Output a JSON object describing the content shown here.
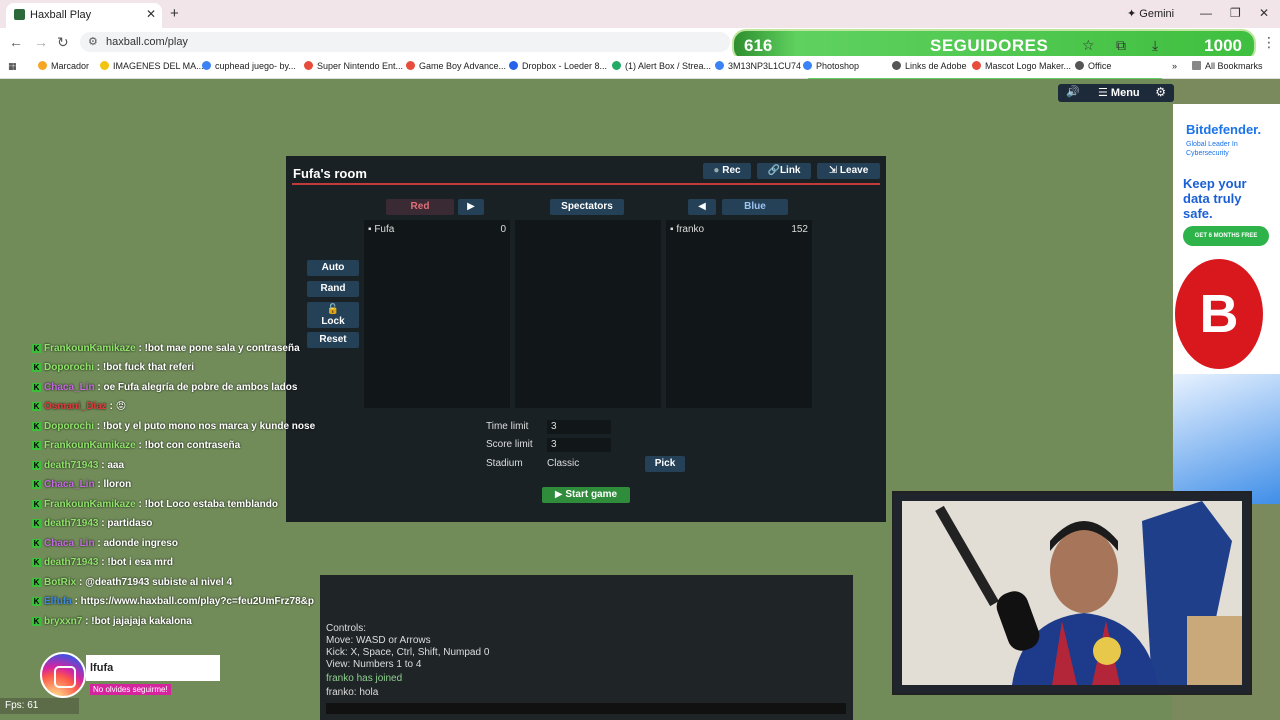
{
  "browser": {
    "tab_title": "Haxball Play",
    "url": "haxball.com/play",
    "gemini_label": "Gemini",
    "bookmarks": [
      "Marcador",
      "IMAGENES DEL MA...",
      "cuphead juego- by...",
      "Super Nintendo Ent...",
      "Game Boy Advance...",
      "Dropbox - Loeder 8...",
      "(1) Alert Box / Strea...",
      "3M13NP3L1CU74",
      "Photoshop",
      "Links de Adobe",
      "Mascot Logo Maker...",
      "Office"
    ],
    "all_bookmarks": "All Bookmarks"
  },
  "followers": {
    "count": "616",
    "label": "SEGUIDORES",
    "goal": "1000"
  },
  "game_menu": {
    "menu_label": "Menu"
  },
  "room": {
    "title": "Fufa's room",
    "rec_label": "Rec",
    "link_label": "Link",
    "leave_label": "Leave",
    "red_label": "Red",
    "spectators_label": "Spectators",
    "blue_label": "Blue",
    "red_players": [
      {
        "name": "Fufa",
        "score": "0"
      }
    ],
    "blue_players": [
      {
        "name": "franko",
        "score": "152"
      }
    ],
    "side_buttons": [
      "Auto",
      "Rand",
      "Lock",
      "Reset"
    ],
    "time_limit_label": "Time limit",
    "time_limit": "3",
    "score_limit_label": "Score limit",
    "score_limit": "3",
    "stadium_label": "Stadium",
    "stadium": "Classic",
    "pick_label": "Pick",
    "start_label": "Start game"
  },
  "chat": [
    {
      "user": "FrankounKamikaze",
      "msg": ": !bot mae pone sala y contraseña",
      "color": "#8fe36a"
    },
    {
      "user": "Doporochi",
      "msg": ": !bot fuck that referi",
      "color": "#8fe36a"
    },
    {
      "user": "Chaca_Lin",
      "msg": ": oe Fufa alegría de pobre de ambos lados",
      "color": "#c46be0"
    },
    {
      "user": "Osmani_Diaz",
      "msg": ": 😡",
      "color": "#e23a3a"
    },
    {
      "user": "Doporochi",
      "msg": ": !bot y el puto mono nos marca y kunde nose",
      "color": "#8fe36a"
    },
    {
      "user": "FrankounKamikaze",
      "msg": ": !bot con contraseña",
      "color": "#8fe36a"
    },
    {
      "user": "death71943",
      "msg": ": aaa",
      "color": "#8fe36a"
    },
    {
      "user": "Chaca_Lin",
      "msg": ": lloron",
      "color": "#c46be0"
    },
    {
      "user": "FrankounKamikaze",
      "msg": ": !bot Loco estaba temblando",
      "color": "#8fe36a"
    },
    {
      "user": "death71943",
      "msg": ": partidaso",
      "color": "#8fe36a"
    },
    {
      "user": "Chaca_Lin",
      "msg": ": adonde ingreso",
      "color": "#c46be0"
    },
    {
      "user": "death71943",
      "msg": ": !bot i esa mrd",
      "color": "#8fe36a"
    },
    {
      "user": "BotRix",
      "msg": ": @death71943 subiste al nivel 4",
      "color": "#8fe36a"
    },
    {
      "user": "Elfufa",
      "msg": ": https://www.haxball.com/play?c=feu2UmFrz78&p",
      "color": "#3a8ae2"
    },
    {
      "user": "bryxxn7",
      "msg": ": !bot jajajaja kakalona",
      "color": "#8fe36a"
    }
  ],
  "controls": {
    "lines": [
      "Controls:",
      "Move: WASD or Arrows",
      "Kick: X, Space, Ctrl, Shift, Numpad 0",
      "View: Numbers 1 to 4"
    ],
    "joined": "franko has joined",
    "last_msg": "franko: hola"
  },
  "ad": {
    "brand": "Bitdefender.",
    "sub": "Global Leader In Cybersecurity",
    "headline": "Keep your data truly safe.",
    "cta": "GET 6 MONTHS FREE",
    "logo_letter": "B"
  },
  "overlay": {
    "insta_name": "lfufa",
    "insta_cta": "No olvides seguirme!",
    "fps": "Fps: 61"
  }
}
